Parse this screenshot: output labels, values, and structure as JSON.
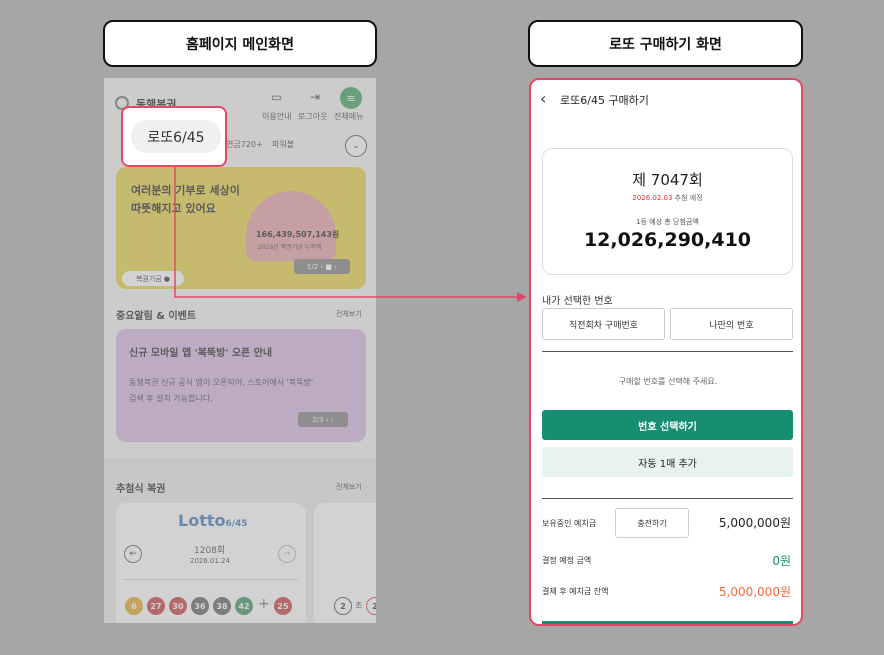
{
  "headers": {
    "left": "홈페이지 메인화면",
    "right": "로또 구매하기 화면"
  },
  "callout": {
    "label": "로또6/45"
  },
  "home": {
    "brand": "동행복권",
    "nav": {
      "guide": "이용안내",
      "logout": "로그아웃",
      "menu": "전체메뉴"
    },
    "chips": [
      "연금720+",
      "파워볼"
    ],
    "banner": {
      "line1": "여러분의 기부로 세상이",
      "line2": "따뜻해지고 있어요",
      "amount": "166,439,507,143원",
      "sub": "2026년 복권기금 누적액",
      "pager": "1/2",
      "tag": "복권기금"
    },
    "notice": {
      "title": "중요알림 & 이벤트",
      "more": "전체보기",
      "card_title": "신규 모바일 앱 '복뚝방' 오픈 안내",
      "card_body1": "동행복권 신규 공식 앱이 오픈되어, 스토어에서 '복뚝방'",
      "card_body2": "검색 후 설치 가능합니다.",
      "pager": "2/3"
    },
    "draw": {
      "title": "추첨식 복권",
      "more": "전체보기",
      "logo": "Lotto",
      "logo_sub": "6/45",
      "round": "1208회",
      "date": "2026.01.24",
      "balls": [
        "6",
        "27",
        "30",
        "36",
        "38",
        "42"
      ],
      "plus": "+",
      "bonus": "25",
      "next_partial": [
        "2",
        "조",
        "2"
      ]
    }
  },
  "purchase": {
    "title": "로또6/45 구매하기",
    "round": "제 7047회",
    "draw_date": "2026.02.03",
    "draw_note": "추첨 예정",
    "expected_label": "1등 예상 총 당첨금액",
    "expected_amount": "12,026,290,410",
    "my_numbers_label": "내가 선택한 번호",
    "tab_recent": "직전회차 구매번호",
    "tab_mine": "나만의 번호",
    "hint": "구매할 번호를 선택해 주세요.",
    "select_btn": "번호 선택하기",
    "auto_btn": "자동 1매 추가",
    "deposit_label": "보유중인 예치금",
    "charge_btn": "충전하기",
    "deposit_amount": "5,000,000원",
    "pay_label": "결정 예정 금액",
    "pay_amount": "0원",
    "after_label": "결제 후 예치금 잔액",
    "after_amount": "5,000,000원"
  },
  "colors": {
    "accent_pink": "#e34866",
    "brand_green": "#178e71",
    "orange": "#f26b3a",
    "red": "#e0302b"
  }
}
